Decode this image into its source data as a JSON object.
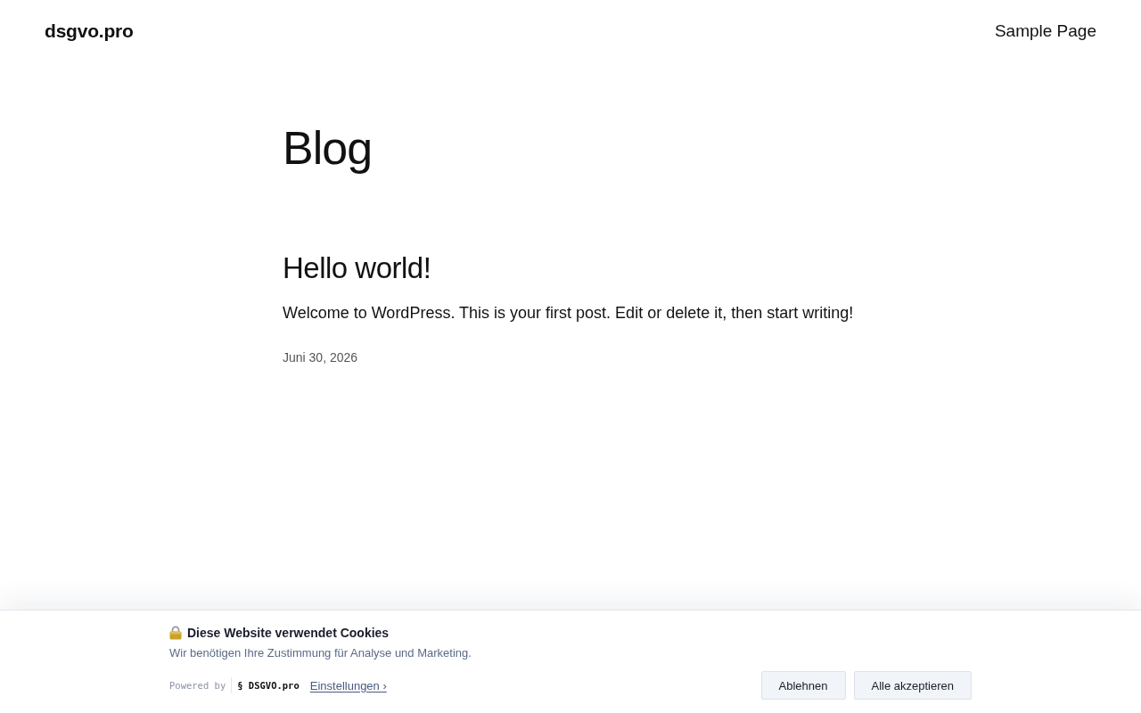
{
  "header": {
    "site_title": "dsgvo.pro",
    "nav": [
      {
        "label": "Sample Page"
      }
    ]
  },
  "page_title": "Blog",
  "posts": [
    {
      "title": "Hello world!",
      "excerpt": "Welcome to WordPress. This is your first post. Edit or delete it, then start writing!",
      "date": "Juni 30, 2026"
    }
  ],
  "cookie_banner": {
    "title": "Diese Website verwendet Cookies",
    "description": "Wir benötigen Ihre Zustimmung für Analyse und Marketing.",
    "powered_by": "Powered by",
    "brand": "§ DSGVO.pro",
    "settings_link": "Einstellungen ›",
    "buttons": [
      "Ablehnen",
      "Alle akzeptieren"
    ]
  }
}
